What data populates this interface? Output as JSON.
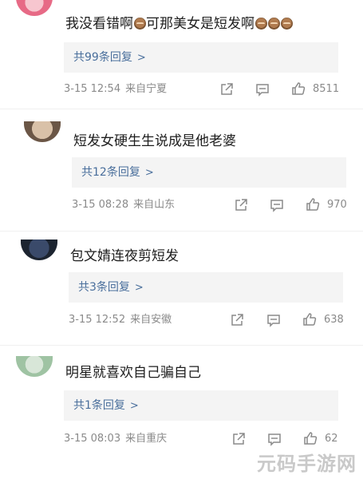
{
  "comments": [
    {
      "text": "我没看错啊",
      "text_tail": "可那美女是短发啊",
      "reply_label": "共99条回复",
      "reply_chevron": ">",
      "time": "3-15 12:54",
      "location": "来自宁夏",
      "likes": "8511"
    },
    {
      "text": "短发女硬生生说成是他老婆",
      "reply_label": "共12条回复",
      "reply_chevron": ">",
      "time": "3-15 08:28",
      "location": "来自山东",
      "likes": "970"
    },
    {
      "text": "包文婧连夜剪短发",
      "reply_label": "共3条回复",
      "reply_chevron": ">",
      "time": "3-15 12:52",
      "location": "来自安徽",
      "likes": "638"
    },
    {
      "text": "明星就喜欢自己骗自己",
      "reply_label": "共1条回复",
      "reply_chevron": ">",
      "time": "3-15 08:03",
      "location": "来自重庆",
      "likes": "62"
    }
  ],
  "watermark": "元码手游网",
  "colors": {
    "link": "#4a6f9c",
    "meta": "#8a8a8a",
    "reply_bg": "#f4f4f4"
  }
}
